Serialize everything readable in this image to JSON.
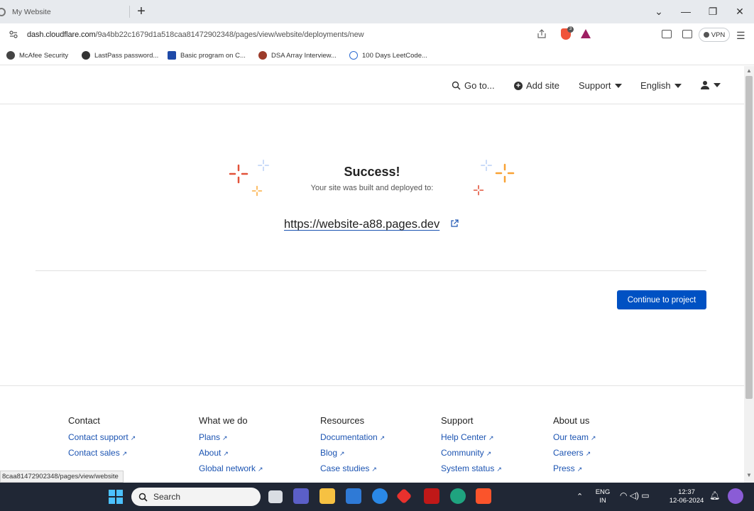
{
  "browser": {
    "tab_title": "My Website",
    "new_tab": "+",
    "url_host": "dash.cloudflare.com",
    "url_path": "/9a4bb22c1679d1a518caa81472902348/pages/view/website/deployments/new",
    "vpn_label": "VPN",
    "window_controls": {
      "collapse": "⌄",
      "minimize": "—",
      "restore": "❐",
      "close": "✕"
    },
    "bookmarks": [
      {
        "label": "McAfee Security",
        "icon": "mcafee-shield-icon"
      },
      {
        "label": "LastPass password...",
        "icon": "globe-icon"
      },
      {
        "label": "Basic program on C...",
        "icon": "ps-icon"
      },
      {
        "label": "DSA Array Interview...",
        "icon": "dsa-icon"
      },
      {
        "label": "100 Days LeetCode...",
        "icon": "leetcode-icon"
      }
    ],
    "status_url": "8caa81472902348/pages/view/website"
  },
  "nav": {
    "goto": "Go to...",
    "add_site": "Add site",
    "support": "Support",
    "language": "English"
  },
  "success": {
    "title": "Success!",
    "subtitle": "Your site was built and deployed to:",
    "url": "https://website-a88.pages.dev",
    "continue_label": "Continue to project"
  },
  "footer": {
    "columns": [
      {
        "title": "Contact",
        "links": [
          "Contact support",
          "Contact sales"
        ]
      },
      {
        "title": "What we do",
        "links": [
          "Plans",
          "About",
          "Global network"
        ]
      },
      {
        "title": "Resources",
        "links": [
          "Documentation",
          "Blog",
          "Case studies"
        ]
      },
      {
        "title": "Support",
        "links": [
          "Help Center",
          "Community",
          "System status"
        ]
      },
      {
        "title": "About us",
        "links": [
          "Our team",
          "Careers",
          "Press"
        ]
      }
    ]
  },
  "taskbar": {
    "search_placeholder": "Search",
    "lang_top": "ENG",
    "lang_bottom": "IN",
    "time": "12:37",
    "date": "12-06-2024"
  },
  "colors": {
    "accent": "#0051c3",
    "link": "#1c54b2",
    "sparkle_orange": "#f38020",
    "sparkle_red": "#e2533a",
    "sparkle_yellow": "#fbad41",
    "sparkle_blue": "#b8cff5"
  }
}
